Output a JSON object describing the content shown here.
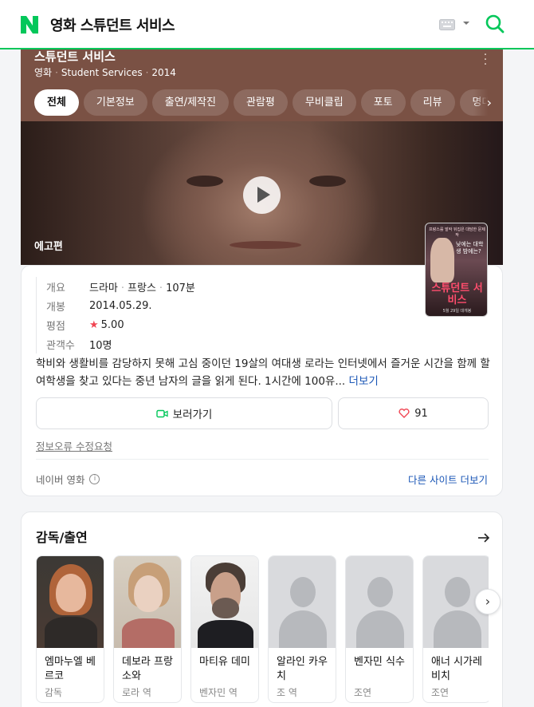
{
  "header": {
    "page_title": "영화 스튜던트 서비스",
    "brand_color": "#03c75a"
  },
  "movie": {
    "title": "스튜던트 서비스",
    "category": "영화",
    "original_title": "Student Services",
    "year": "2014",
    "trailer_label": "에고편",
    "tabs": [
      {
        "label": "전체",
        "active": true
      },
      {
        "label": "기본정보"
      },
      {
        "label": "출연/제작진"
      },
      {
        "label": "관람평"
      },
      {
        "label": "무비클립"
      },
      {
        "label": "포토"
      },
      {
        "label": "리뷰"
      },
      {
        "label": "명대"
      }
    ],
    "poster": {
      "title": "스튜던트 서비스",
      "tagline": "낮에는 대학생 밤에는?",
      "top_text": "프랑스를 발칵 뒤집은 대담한 문제작",
      "bottom_text": "5월 29일 대개봉"
    }
  },
  "info": {
    "rows": [
      {
        "key": "개요",
        "values": [
          "드라마",
          "프랑스",
          "107분"
        ]
      },
      {
        "key": "개봉",
        "value": "2014.05.29."
      },
      {
        "key": "평점",
        "value": "5.00",
        "icon": "star-icon"
      },
      {
        "key": "관객수",
        "value": "10명"
      }
    ],
    "synopsis": "학비와 생활비를 감당하지 못해 고심 중이던 19살의 여대생 로라는 인터넷에서 즐거운 시간을 함께 할 여학생을 찾고 있다는 중년 남자의 글을 읽게 된다. 1시간에 100유...",
    "more_label": "더보기",
    "watch_label": "보러가기",
    "like_count": "91",
    "error_report_label": "정보오류 수정요청",
    "source_label": "네이버 영화",
    "other_sites_label": "다른 사이트 더보기"
  },
  "cast": {
    "title": "감독/출연",
    "people": [
      {
        "name": "엠마누엘 베르코",
        "role": "감독"
      },
      {
        "name": "데보라 프랑소와",
        "role": "로라 역"
      },
      {
        "name": "마티유 데미",
        "role": "벤자민 역"
      },
      {
        "name": "알라인 카우치",
        "role": "조 역"
      },
      {
        "name": "벤자민 식수",
        "role": "조연"
      },
      {
        "name": "애너 시가레비치",
        "role": "조연"
      }
    ]
  }
}
